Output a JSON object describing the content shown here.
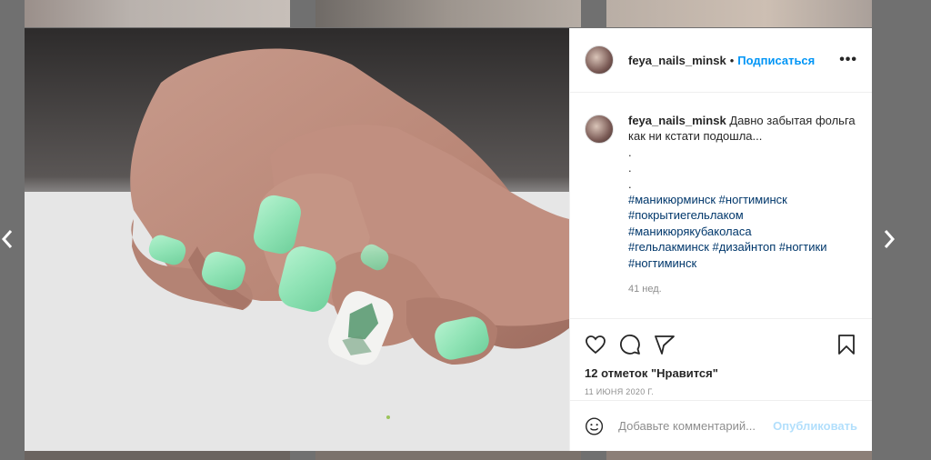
{
  "post": {
    "username": "feya_nails_minsk",
    "follow_label": "Подписаться",
    "more_label": "•••",
    "separator": "•",
    "caption_text": "Давно забытая фольга как ни кстати подошла...",
    "caption_dots": [
      ".",
      ".",
      "."
    ],
    "hashtags_lines": [
      "#маникюрминск #ногтиминск",
      "#покрытиегельлаком",
      "#маникюрякубаколаса",
      "#гельлакминск #дизайнтоп #ногтики",
      "#ногтиминск"
    ],
    "comment_time": "41 нед.",
    "likes": "12 отметок \"Нравится\"",
    "date": "11 ИЮНЯ 2020 Г.",
    "comment_placeholder": "Добавьте комментарий...",
    "publish_label": "Опубликовать"
  },
  "icons": {
    "prev": "chevron-left-icon",
    "next": "chevron-right-icon",
    "like": "heart-icon",
    "comment": "comment-bubble-icon",
    "share": "paper-plane-icon",
    "save": "bookmark-icon",
    "emoji": "smile-icon"
  },
  "colors": {
    "accent": "#0095f6",
    "hashtag": "#00376b",
    "muted": "#8e8e8e",
    "nail_mint": "#8fe3b5"
  }
}
